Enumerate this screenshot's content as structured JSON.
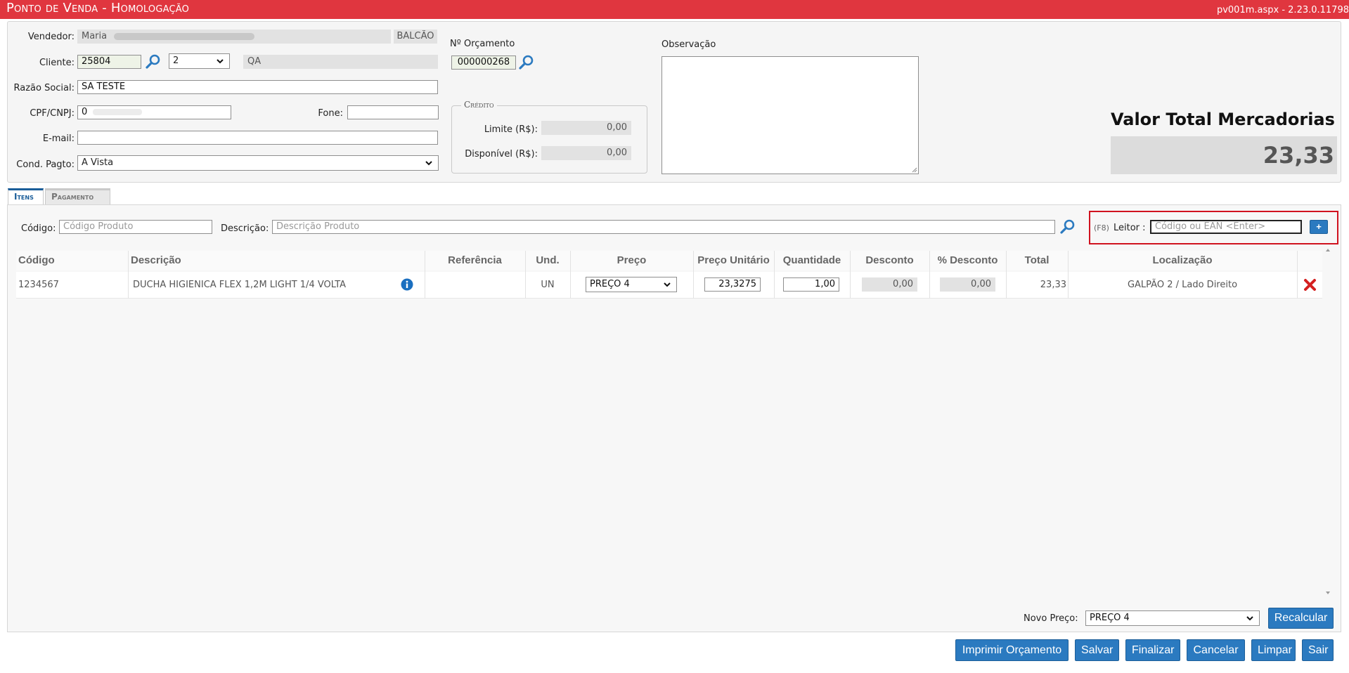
{
  "app": {
    "title": "Ponto de Venda  - Homologação",
    "version": "pv001m.aspx - 2.23.0.11798"
  },
  "form": {
    "vendedor_label": "Vendedor:",
    "vendedor_value": "Maria",
    "vendedor_type": "BALCÃO",
    "orcamento_label": "Nº Orçamento",
    "orcamento_value": "000000268",
    "observacao_label": "Observação",
    "cliente_label": "Cliente:",
    "cliente_code": "25804",
    "cliente_select": "2",
    "cliente_name": "QA",
    "razao_label": "Razão Social:",
    "razao_value": "SA TESTE",
    "cpf_label": "CPF/CNPJ:",
    "cpf_value": "0",
    "fone_label": "Fone:",
    "fone_value": "",
    "email_label": "E-mail:",
    "email_value": "",
    "cond_label": "Cond. Pagto:",
    "cond_value": "A Vista"
  },
  "credito": {
    "title": "Crédito",
    "limite_label": "Limite (R$):",
    "limite_value": "0,00",
    "disponivel_label": "Disponível (R$):",
    "disponivel_value": "0,00"
  },
  "total": {
    "label": "Valor Total Mercadorias",
    "value": "23,33"
  },
  "tabs": [
    {
      "label": "Itens",
      "active": true
    },
    {
      "label": "Pagamento",
      "active": false
    }
  ],
  "search": {
    "codigo_label": "Código:",
    "codigo_placeholder": "Código Produto",
    "descricao_label": "Descrição:",
    "descricao_placeholder": "Descrição Produto",
    "leitor_hint": "(F8)",
    "leitor_label": "Leitor :",
    "leitor_placeholder": "Código ou EAN <Enter>",
    "add_label": "+"
  },
  "table": {
    "headers": [
      "Código",
      "Descrição",
      "Referência",
      "Und.",
      "Preço",
      "Preço Unitário",
      "Quantidade",
      "Desconto",
      "% Desconto",
      "Total",
      "Localização"
    ],
    "rows": [
      {
        "codigo": "1234567",
        "descricao": "DUCHA HIGIENICA FLEX 1,2M LIGHT 1/4 VOLTA",
        "referencia": "",
        "und": "UN",
        "preco": "PREÇO 4",
        "preco_unitario": "23,3275",
        "quantidade": "1,00",
        "desconto": "0,00",
        "pct_desconto": "0,00",
        "total": "23,33",
        "localizacao": "GALPÃO 2 / Lado Direito"
      }
    ]
  },
  "bottom": {
    "novo_preco_label": "Novo Preço:",
    "novo_preco_value": "PREÇO 4",
    "recalcular_label": "Recalcular"
  },
  "actions": {
    "imprimir": "Imprimir Orçamento",
    "salvar": "Salvar",
    "finalizar": "Finalizar",
    "cancelar": "Cancelar",
    "limpar": "Limpar",
    "sair": "Sair"
  },
  "colors": {
    "topbar": "#e0363f",
    "accent": "#2b7ac0",
    "highlight_frame": "#d0121f",
    "delete": "#d42020"
  }
}
